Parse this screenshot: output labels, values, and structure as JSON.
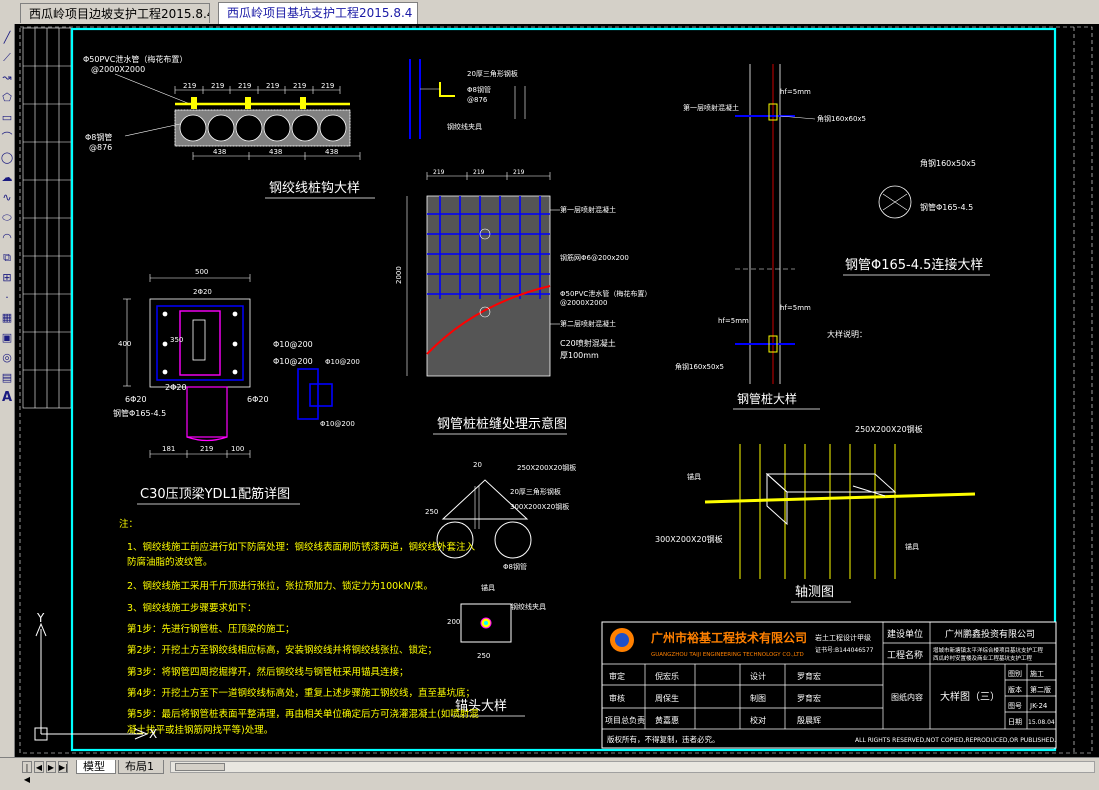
{
  "tabs": [
    {
      "label": "西瓜岭项目边坡支护工程2015.8.4",
      "active": false
    },
    {
      "label": "西瓜岭项目基坑支护工程2015.8.4",
      "active": true
    }
  ],
  "toolbar": {
    "icons": [
      "line-icon",
      "construction-line-icon",
      "polyline-icon",
      "polygon-icon",
      "rectangle-icon",
      "arc-icon",
      "circle-icon",
      "revision-cloud-icon",
      "spline-icon",
      "ellipse-icon",
      "ellipse-arc-icon",
      "insert-block-icon",
      "make-block-icon",
      "point-icon",
      "hatch-icon",
      "gradient-icon",
      "region-icon",
      "table-icon",
      "multiline-text-icon"
    ],
    "text_tool_label": "A"
  },
  "drawing": {
    "titles": {
      "anchor_detail": "钢绞线桩钩大样",
      "beam_detail": "C30压顶梁YDL1配筋详图",
      "joint_treatment": "钢管桩桩缝处理示意图",
      "pile_connection": "钢管Φ165-4.5连接大样",
      "steel_pile_detail": "钢管桩大样",
      "axonometric": "轴测图",
      "anchor_head": "锚头大样"
    },
    "labels": {
      "pvc_pipe": "Φ50PVC泄水管（梅花布置）",
      "pvc_spacing": "@2000X2000",
      "bar_219": "219",
      "bar_438": "438",
      "steel_pile": "Φ8钢管",
      "steel_pile_spacing": "@876",
      "dim_500": "500",
      "dim_400": "400",
      "dim_350": "350",
      "rebar_top": "2Φ20",
      "rebar_stirrup1": "Φ10@200",
      "rebar_stirrup2": "Φ10@200",
      "rebar_bottom": "6Φ20",
      "steel_pipe": "钢管Φ165-4.5",
      "dim_181": "181",
      "dim_100": "100",
      "dim_2000": "2000",
      "dim_200": "200",
      "mesh_label": "钢筋网Φ6@200x200",
      "concrete_label": "C20喷射混凝土",
      "thickness": "厚100mm",
      "first_layer": "第一层喷射混凝土",
      "second_layer": "第二层喷射混凝土",
      "hf_weld": "hf=5mm",
      "angle_steel": "角钢160x60x5",
      "angle_steel2": "角钢160x50x5",
      "pipe_spec": "钢管Φ165-4.5",
      "plate_250": "250X200X20钢板",
      "plate_300": "300X200X20钢板",
      "rib_plate": "20厚三角形钢板",
      "dim_250": "250",
      "dim_20": "20",
      "anchor_label": "锚具",
      "anchor_cable": "钢绞线夹具",
      "note_heading": "大样说明："
    },
    "notes": [
      "注：",
      "1、钢绞线施工前应进行如下防腐处理：钢绞线表面刷防锈漆两道，钢绞线外套注入",
      "防腐油脂的波纹管。",
      "2、钢绞线施工采用千斤顶进行张拉，张拉预加力、锁定力为100kN/束。",
      "3、钢绞线施工步骤要求如下：",
      "第1步：先进行钢管桩、压顶梁的施工；",
      "第2步：开挖土方至钢绞线相应标高，安装钢绞线并将钢绞线张拉、锁定；",
      "第3步：将钢管四周挖掘撑开，然后钢绞线与钢管桩采用锚具连接；",
      "第4步：开挖土方至下一道钢绞线标高处，重复上述步骤施工钢绞线，直至基坑底；",
      "第5步：最后将钢管桩表面平整清理，再由相关单位确定后方可浇灌混凝土(如喷射混",
      "凝土找平或挂钢筋网找平等)处理。"
    ],
    "title_block": {
      "company": "广州市裕基工程技术有限公司",
      "company_en": "GUANGZHOU TAIJI ENGINEERING TECHNOLOGY CO.,LTD",
      "qualification": "岩土工程设计甲级",
      "cert_no": "证书号:B144046577",
      "client_label": "建设单位",
      "client": "广州鹏鑫投资有限公司",
      "project_label": "工程名称",
      "project_name": "增城市新塘镇太平洋综合楼项目基坑支护工程",
      "project_name2": "西瓜岭村安置楼及商业工程基坑支护工程",
      "row_labels": [
        "审定",
        "审核",
        "项目总负责"
      ],
      "row_values": [
        "倪宏乐",
        "周保生",
        "黄嘉惠"
      ],
      "design_labels": [
        "设计",
        "制图",
        "校对"
      ],
      "design_values": [
        "罗育宏",
        "罗育宏",
        "殷晨辉"
      ],
      "drawing_content_label": "图纸内容",
      "drawing_content": "大样图（三）",
      "meta_labels": [
        "图别",
        "版本",
        "图号",
        "日期"
      ],
      "meta_values": [
        "施工",
        "第二版",
        "JK-24",
        "15.08.04"
      ],
      "footer_left": "版权所有，不得复制，违者必究。",
      "footer_right": "ALL RIGHTS RESERVED,NOT COPIED,REPRODUCED,OR PUBLISHED."
    },
    "ucs": {
      "x": "X",
      "y": "Y"
    }
  },
  "layout_tabs": [
    {
      "label": "模型",
      "active": true
    },
    {
      "label": "布局1",
      "active": false
    }
  ],
  "colors": {
    "canvas": "#000000",
    "border": "#00ffff",
    "line": "#ffffff",
    "yellow": "#ffff00",
    "green": "#00ff00",
    "cyan": "#00ffff",
    "blue": "#0000ff",
    "red": "#ff0000",
    "magenta": "#ff00ff",
    "orange": "#ff8000",
    "title_company": "#ff8000"
  }
}
